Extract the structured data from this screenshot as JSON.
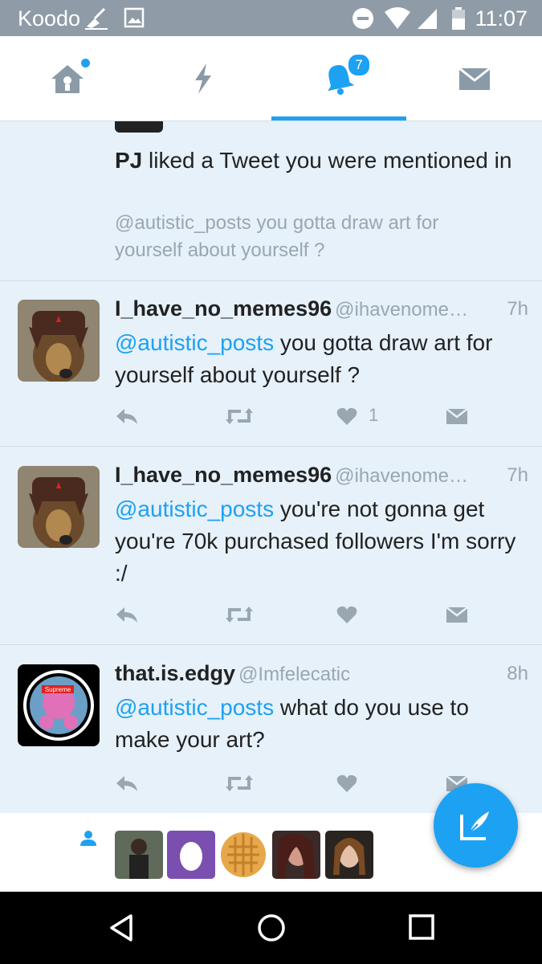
{
  "status_bar": {
    "carrier": "Koodo",
    "time": "11:07"
  },
  "tabs": [
    {
      "name": "Home",
      "icon": "home-icon",
      "has_dot": true
    },
    {
      "name": "Moments",
      "icon": "lightning-icon"
    },
    {
      "name": "Notifications",
      "icon": "bell-icon",
      "badge": "7",
      "active": true
    },
    {
      "name": "Messages",
      "icon": "envelope-icon"
    }
  ],
  "notification": {
    "actor": "PJ",
    "text": " liked a Tweet you were mentioned in",
    "quote": "@autistic_posts you gotta draw art for yourself about yourself ?"
  },
  "tweets": [
    {
      "name": "I_have_no_memes96",
      "handle": "@ihavenome…",
      "time": "7h",
      "mention": "@autistic_posts",
      "text": " you gotta draw art for yourself about yourself ?",
      "like_count": "1"
    },
    {
      "name": "I_have_no_memes96",
      "handle": "@ihavenome…",
      "time": "7h",
      "mention": "@autistic_posts",
      "text": " you're not gonna get you're 70k purchased followers I'm sorry :/",
      "like_count": ""
    },
    {
      "name": "that.is.edgy",
      "handle": "@Imfelecatic",
      "time": "8h",
      "mention": "@autistic_posts",
      "text": " what do you use to make your art?",
      "like_count": ""
    }
  ],
  "avatar3_label": "Supreme",
  "colors": {
    "accent": "#1da1f2",
    "muted": "#9aa6b0",
    "status_bar": "#8f9ca7",
    "feed_bg": "#e6f1fa"
  }
}
